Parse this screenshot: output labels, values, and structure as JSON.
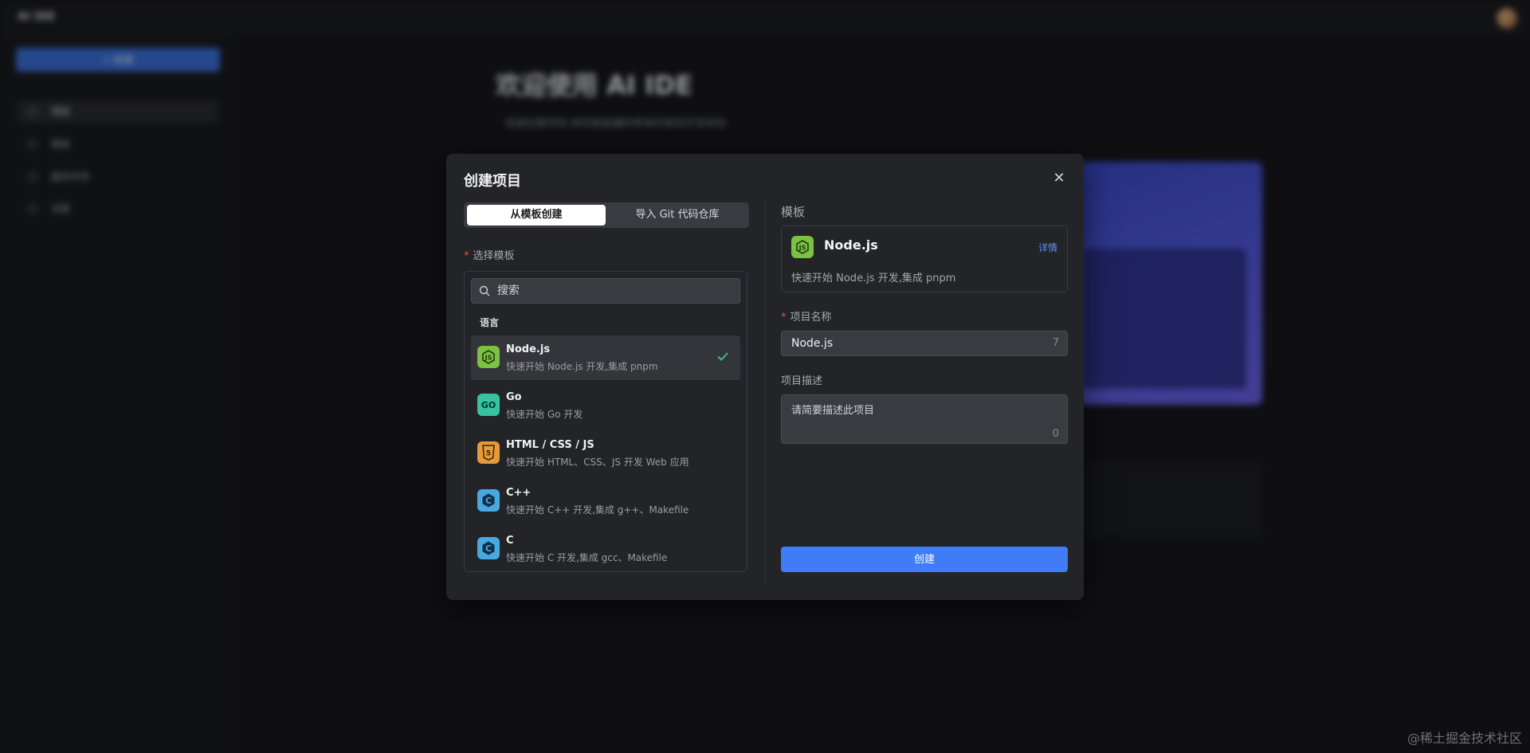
{
  "background": {
    "brand": "AI IDE",
    "new_button": "+ 新建",
    "nav": [
      "项目",
      "模板",
      "服务市场",
      "设置"
    ],
    "title": "欢迎使用 AI IDE",
    "subtitle": "快速创建项目,体验智能编码带来的高效开发体验"
  },
  "dialog": {
    "title": "创建项目",
    "close_icon": "close-icon",
    "tabs": [
      {
        "label": "从模板创建",
        "active": true
      },
      {
        "label": "导入 Git 代码仓库",
        "active": false
      }
    ],
    "select_label": "选择模板",
    "search_placeholder": "搜索",
    "group_label": "语言",
    "templates": [
      {
        "name": "Node.js",
        "desc": "快速开始 Node.js 开发,集成 pnpm",
        "icon": "nodejs-icon",
        "color": "#7cc142",
        "selected": true
      },
      {
        "name": "Go",
        "desc": "快速开始 Go 开发",
        "icon": "go-icon",
        "color": "#36c3a1",
        "selected": false
      },
      {
        "name": "HTML / CSS / JS",
        "desc": "快速开始 HTML、CSS、JS 开发 Web 应用",
        "icon": "html5-icon",
        "color": "#e59a3c",
        "selected": false
      },
      {
        "name": "C++",
        "desc": "快速开始 C++ 开发,集成 g++、Makefile",
        "icon": "cpp-icon",
        "color": "#4aa8e0",
        "selected": false
      },
      {
        "name": "C",
        "desc": "快速开始 C 开发,集成 gcc、Makefile",
        "icon": "c-icon",
        "color": "#4aa8e0",
        "selected": false
      }
    ],
    "right": {
      "template_label": "模板",
      "template_name": "Node.js",
      "detail_link": "详情",
      "template_desc": "快速开始 Node.js 开发,集成 pnpm",
      "name_label": "项目名称",
      "name_value": "Node.js",
      "name_count": "7",
      "desc_label": "项目描述",
      "desc_placeholder": "请简要描述此项目",
      "desc_count": "0",
      "create_button": "创建"
    }
  },
  "watermark": "@稀土掘金技术社区",
  "colors": {
    "accent": "#3f7cf5",
    "link": "#5b8ff9",
    "required": "#e0534d",
    "check": "#3fbf7f"
  }
}
